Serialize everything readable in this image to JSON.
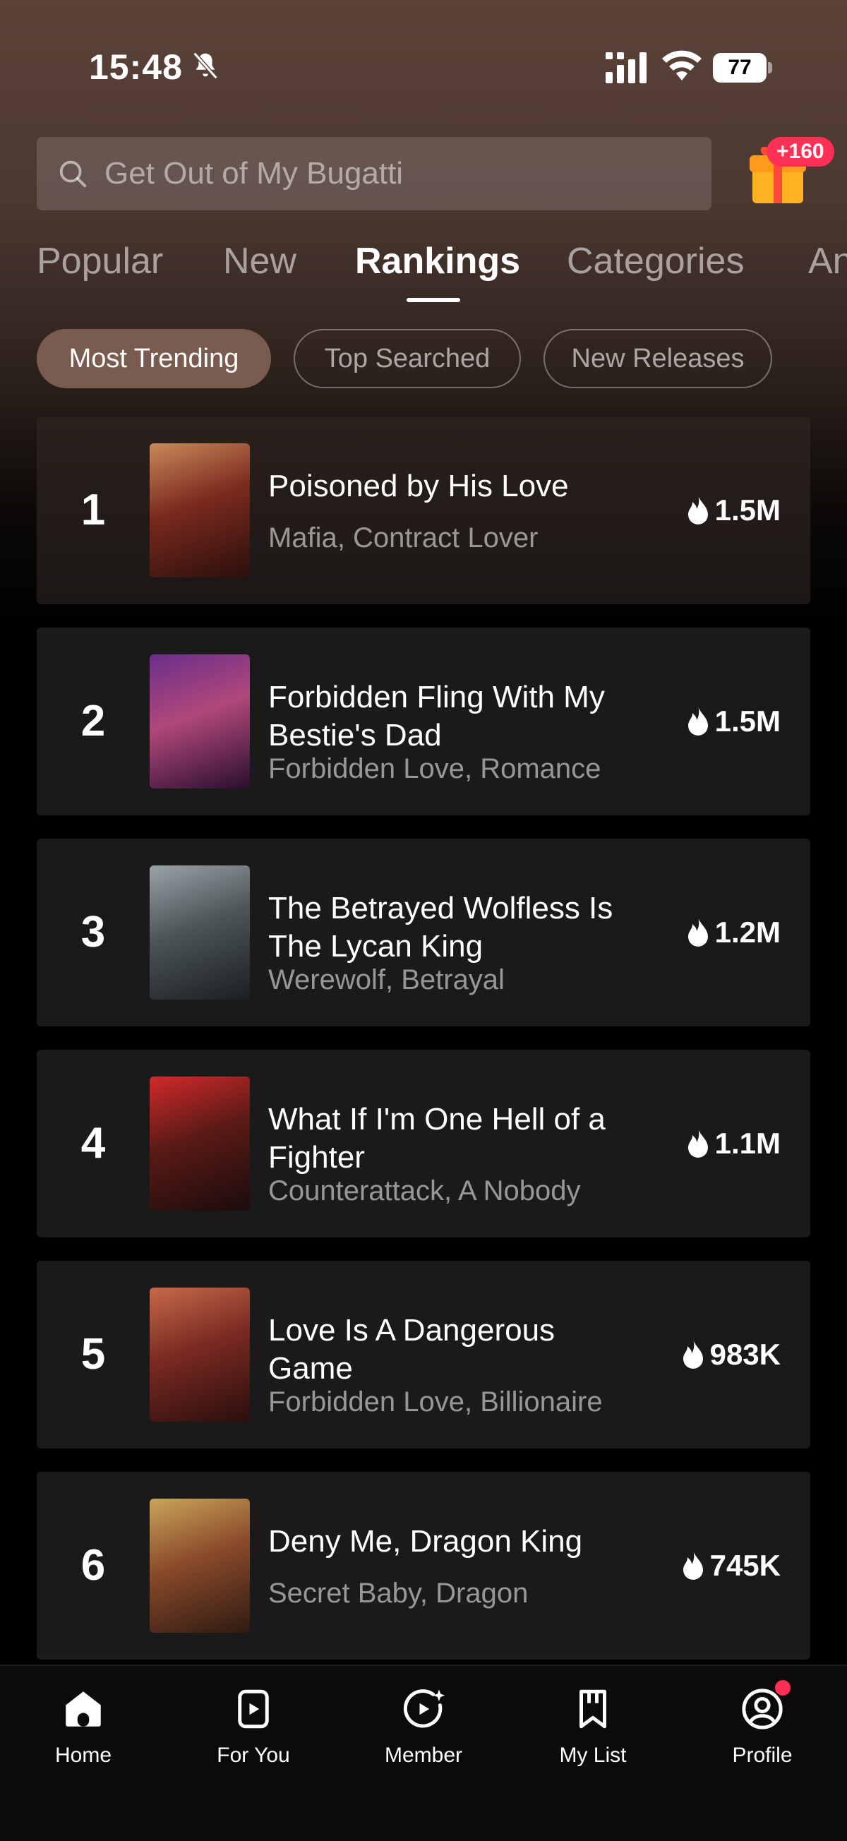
{
  "status_bar": {
    "time": "15:48",
    "battery": "77"
  },
  "search": {
    "placeholder": "Get Out of My Bugatti"
  },
  "gift": {
    "badge": "+160"
  },
  "tabs": [
    "Popular",
    "New",
    "Rankings",
    "Categories",
    "An"
  ],
  "active_tab": "Rankings",
  "filters": [
    "Most Trending",
    "Top Searched",
    "New Releases"
  ],
  "active_filter": "Most Trending",
  "items": [
    {
      "rank": "1",
      "title": "Poisoned by His Love",
      "tags": "Mafia, Contract Lover",
      "heat": "1.5M"
    },
    {
      "rank": "2",
      "title": "Forbidden Fling With My Bestie's Dad",
      "tags": "Forbidden Love, Romance",
      "heat": "1.5M"
    },
    {
      "rank": "3",
      "title": "The Betrayed Wolfless Is The Lycan King",
      "tags": "Werewolf, Betrayal",
      "heat": "1.2M"
    },
    {
      "rank": "4",
      "title": "What If I'm One Hell of a Fighter",
      "tags": "Counterattack, A Nobody",
      "heat": "1.1M"
    },
    {
      "rank": "5",
      "title": "Love Is A Dangerous Game",
      "tags": "Forbidden Love, Billionaire",
      "heat": "983K"
    },
    {
      "rank": "6",
      "title": "Deny Me, Dragon King",
      "tags": "Secret Baby, Dragon",
      "heat": "745K"
    }
  ],
  "nav": [
    "Home",
    "For You",
    "Member",
    "My List",
    "Profile"
  ],
  "colors": {
    "accent_chip": "#7a5b4f",
    "badge": "#ff2f56",
    "card": "#1a1a1a"
  }
}
